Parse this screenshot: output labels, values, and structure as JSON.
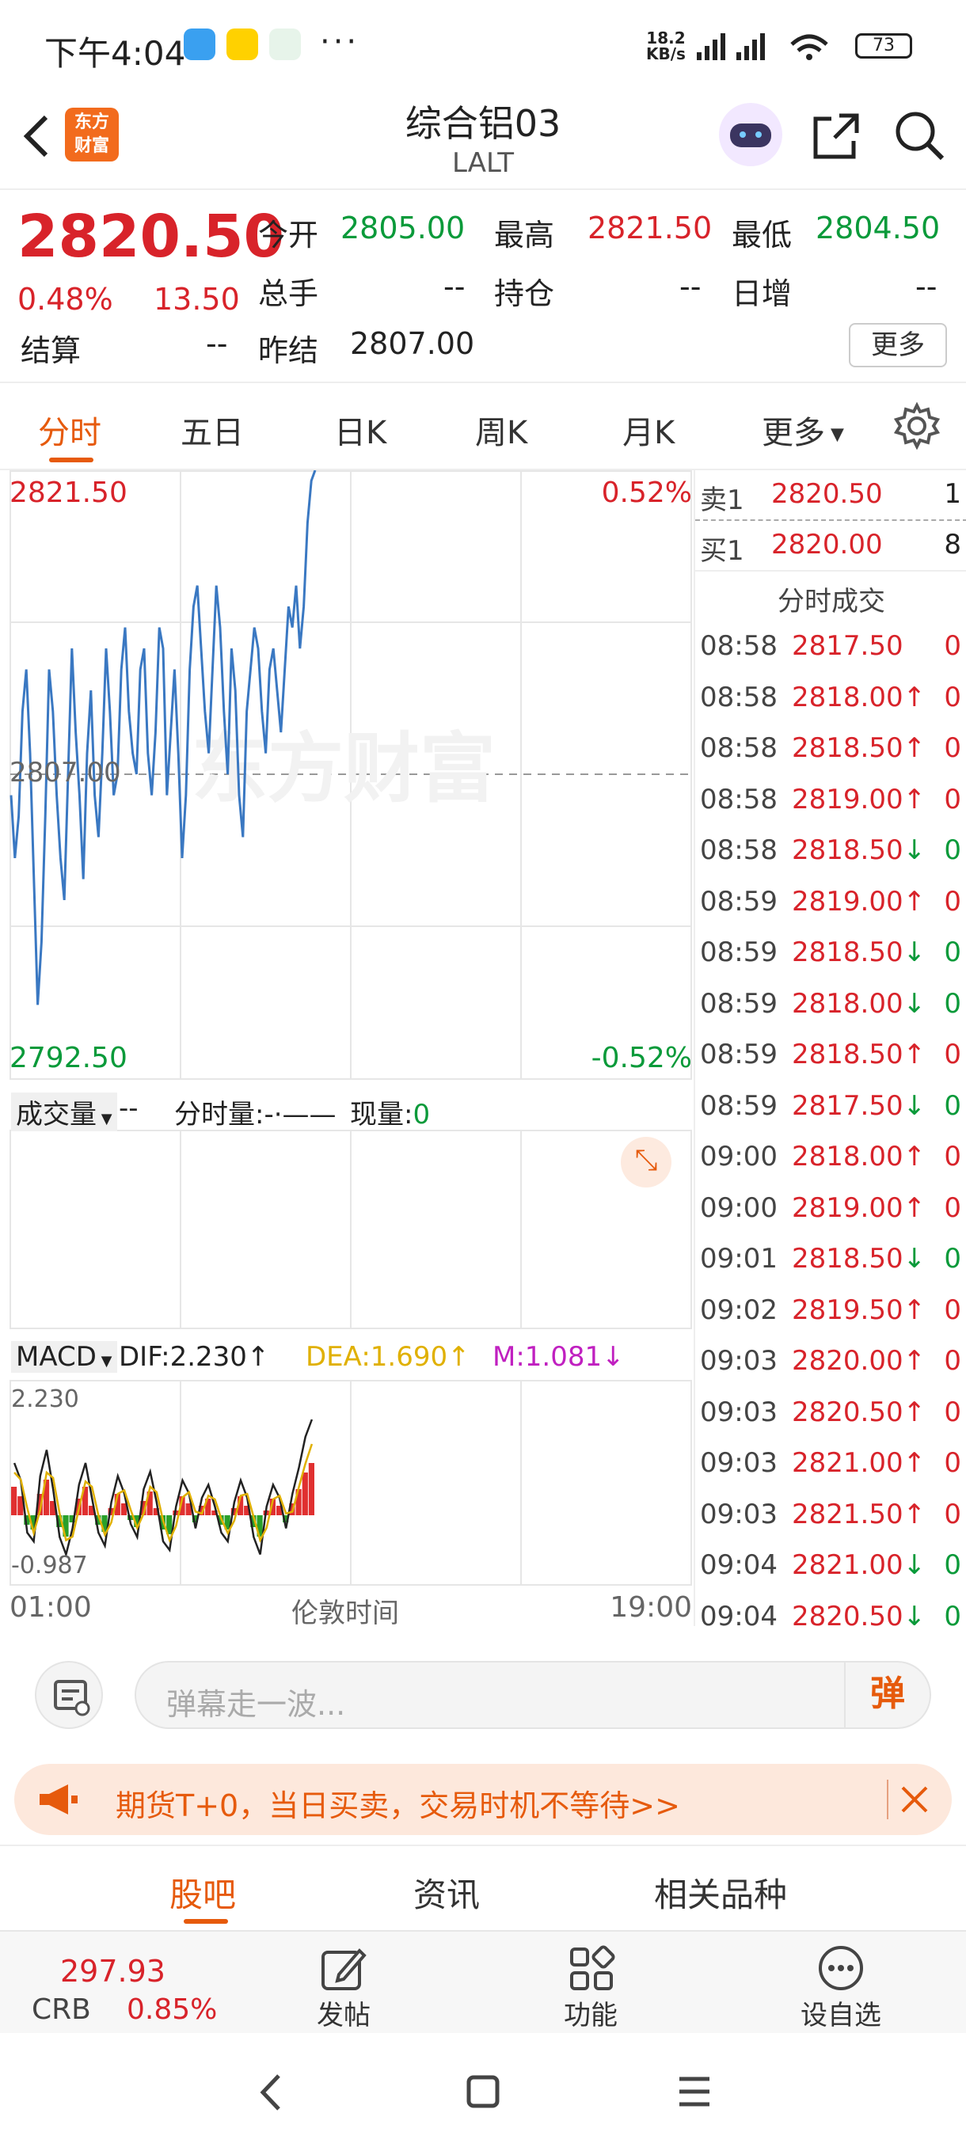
{
  "status_bar": {
    "time": "下午4:04",
    "dots": "···",
    "net_speed": "18.2",
    "net_unit": "KB/s",
    "battery": "73"
  },
  "header": {
    "logo_line1": "东方",
    "logo_line2": "财富",
    "title": "综合铝03",
    "code": "LALT"
  },
  "quote": {
    "price": "2820.50",
    "change_pct": "0.48%",
    "change_abs": "13.50",
    "open_label": "今开",
    "open": "2805.00",
    "high_label": "最高",
    "high": "2821.50",
    "low_label": "最低",
    "low": "2804.50",
    "volume_label": "总手",
    "volume": "--",
    "oi_label": "持仓",
    "oi": "--",
    "daily_inc_label": "日增",
    "daily_inc": "--",
    "settle_label": "结算",
    "settle": "--",
    "prev_settle_label": "昨结",
    "prev_settle": "2807.00",
    "more_button": "更多"
  },
  "tabs": [
    {
      "label": "分时",
      "active": true
    },
    {
      "label": "五日"
    },
    {
      "label": "日K"
    },
    {
      "label": "周K"
    },
    {
      "label": "月K"
    },
    {
      "label": "更多"
    }
  ],
  "intraday": {
    "top_price": "2821.50",
    "top_pct": "0.52%",
    "bottom_price": "2792.50",
    "bottom_pct": "-0.52%",
    "ref_price": "2807.00",
    "watermark": "东方财富",
    "price_series": [
      2806,
      2803,
      2805,
      2810,
      2812,
      2808,
      2802,
      2796,
      2799,
      2805,
      2812,
      2810,
      2806,
      2803,
      2801,
      2807,
      2813,
      2809,
      2806,
      2802,
      2808,
      2811,
      2806,
      2804,
      2808,
      2813,
      2810,
      2806,
      2807,
      2812,
      2814,
      2810,
      2808,
      2807,
      2812,
      2813,
      2808,
      2806,
      2809,
      2814,
      2813,
      2806,
      2809,
      2812,
      2808,
      2803,
      2806,
      2812,
      2815,
      2816,
      2813,
      2810,
      2808,
      2812,
      2816,
      2814,
      2810,
      2807,
      2813,
      2811,
      2806,
      2804,
      2810,
      2812,
      2814,
      2813,
      2810,
      2808,
      2812,
      2813,
      2811,
      2809,
      2812,
      2815,
      2814,
      2816,
      2813,
      2815,
      2819,
      2821,
      2821.5
    ]
  },
  "volume_panel": {
    "label": "成交量",
    "dash": "--",
    "time_vol": "分时量:-·——",
    "now_vol_label": "现量:",
    "now_vol": "0"
  },
  "macd": {
    "label": "MACD",
    "dif": "DIF:2.230↑",
    "dea": "DEA:1.690↑",
    "m": "M:1.081↓",
    "top": "2.230",
    "bottom": "-0.987",
    "bars": [
      1.2,
      0.8,
      -0.4,
      -0.6,
      0.9,
      1.5,
      0.6,
      -0.5,
      -0.9,
      -0.3,
      0.7,
      1.2,
      0.4,
      -0.4,
      -0.7,
      0.3,
      0.9,
      0.5,
      -0.2,
      -0.5,
      0.6,
      1.0,
      0.3,
      -0.6,
      -0.8,
      0.2,
      0.8,
      0.5,
      -0.3,
      0.4,
      0.7,
      0.2,
      -0.4,
      -0.6,
      0.3,
      0.8,
      0.4,
      -0.5,
      -0.9,
      0.2,
      0.7,
      0.4,
      -0.3,
      0.5,
      1.1,
      1.8,
      2.2
    ]
  },
  "axis": {
    "start": "01:00",
    "mid": "伦敦时间",
    "end": "19:00"
  },
  "order_book": {
    "ask_label": "卖1",
    "ask_price": "2820.50",
    "ask_vol": "1",
    "bid_label": "买1",
    "bid_price": "2820.00",
    "bid_vol": "8",
    "ticks_title": "分时成交"
  },
  "ticks": [
    {
      "time": "08:58",
      "price": "2817.50",
      "arrow": "",
      "vol": "0",
      "vol_color": "red"
    },
    {
      "time": "08:58",
      "price": "2818.00",
      "arrow": "↑",
      "vol": "0",
      "vol_color": "red"
    },
    {
      "time": "08:58",
      "price": "2818.50",
      "arrow": "↑",
      "vol": "0",
      "vol_color": "red"
    },
    {
      "time": "08:58",
      "price": "2819.00",
      "arrow": "↑",
      "vol": "0",
      "vol_color": "red"
    },
    {
      "time": "08:58",
      "price": "2818.50",
      "arrow": "↓",
      "vol": "0",
      "vol_color": "green"
    },
    {
      "time": "08:59",
      "price": "2819.00",
      "arrow": "↑",
      "vol": "0",
      "vol_color": "red"
    },
    {
      "time": "08:59",
      "price": "2818.50",
      "arrow": "↓",
      "vol": "0",
      "vol_color": "green"
    },
    {
      "time": "08:59",
      "price": "2818.00",
      "arrow": "↓",
      "vol": "0",
      "vol_color": "green"
    },
    {
      "time": "08:59",
      "price": "2818.50",
      "arrow": "↑",
      "vol": "0",
      "vol_color": "red"
    },
    {
      "time": "08:59",
      "price": "2817.50",
      "arrow": "↓",
      "vol": "0",
      "vol_color": "green"
    },
    {
      "time": "09:00",
      "price": "2818.00",
      "arrow": "↑",
      "vol": "0",
      "vol_color": "red"
    },
    {
      "time": "09:00",
      "price": "2819.00",
      "arrow": "↑",
      "vol": "0",
      "vol_color": "red"
    },
    {
      "time": "09:01",
      "price": "2818.50",
      "arrow": "↓",
      "vol": "0",
      "vol_color": "green"
    },
    {
      "time": "09:02",
      "price": "2819.50",
      "arrow": "↑",
      "vol": "0",
      "vol_color": "red"
    },
    {
      "time": "09:03",
      "price": "2820.00",
      "arrow": "↑",
      "vol": "0",
      "vol_color": "red"
    },
    {
      "time": "09:03",
      "price": "2820.50",
      "arrow": "↑",
      "vol": "0",
      "vol_color": "red"
    },
    {
      "time": "09:03",
      "price": "2821.00",
      "arrow": "↑",
      "vol": "0",
      "vol_color": "red"
    },
    {
      "time": "09:03",
      "price": "2821.50",
      "arrow": "↑",
      "vol": "0",
      "vol_color": "red"
    },
    {
      "time": "09:04",
      "price": "2821.00",
      "arrow": "↓",
      "vol": "0",
      "vol_color": "green"
    },
    {
      "time": "09:04",
      "price": "2820.50",
      "arrow": "↓",
      "vol": "0",
      "vol_color": "green"
    }
  ],
  "comment": {
    "placeholder": "弹幕走一波...",
    "danmaku_label": "弹"
  },
  "promo": {
    "text": "期货T+0，当日买卖，交易时机不等待>>"
  },
  "bottom_tabs": [
    {
      "label": "股吧",
      "active": true
    },
    {
      "label": "资讯"
    },
    {
      "label": "相关品种"
    }
  ],
  "toolbar": {
    "crb_value": "297.93",
    "crb_label": "CRB",
    "crb_pct": "0.85%",
    "post": "发帖",
    "func": "功能",
    "watch": "设自选"
  },
  "colors": {
    "up": "#d8232a",
    "down": "#0a9a3a",
    "accent": "#e65a0c",
    "line": "#3a78c2"
  }
}
